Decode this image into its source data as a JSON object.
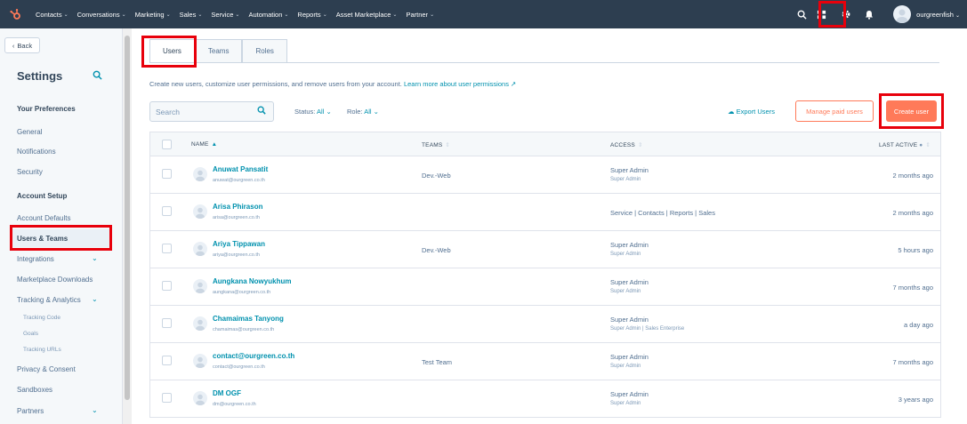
{
  "nav": {
    "items": [
      {
        "label": "Contacts"
      },
      {
        "label": "Conversations"
      },
      {
        "label": "Marketing"
      },
      {
        "label": "Sales"
      },
      {
        "label": "Service"
      },
      {
        "label": "Automation"
      },
      {
        "label": "Reports"
      },
      {
        "label": "Asset Marketplace"
      },
      {
        "label": "Partner"
      }
    ],
    "account_name": "ourgreenfish",
    "chevron": "⌄"
  },
  "sidebar": {
    "back_label": "Back",
    "title": "Settings",
    "items": [
      {
        "label": "Your Preferences"
      },
      {
        "label": "General"
      },
      {
        "label": "Notifications"
      },
      {
        "label": "Security"
      },
      {
        "label": "Account Setup"
      },
      {
        "label": "Account Defaults"
      },
      {
        "label": "Users & Teams"
      },
      {
        "label": "Integrations"
      },
      {
        "label": "Marketplace Downloads"
      },
      {
        "label": "Tracking & Analytics"
      },
      {
        "label": "Tracking Code"
      },
      {
        "label": "Goals"
      },
      {
        "label": "Tracking URLs"
      },
      {
        "label": "Privacy & Consent"
      },
      {
        "label": "Sandboxes"
      },
      {
        "label": "Partners"
      }
    ]
  },
  "tabs": [
    {
      "label": "Users"
    },
    {
      "label": "Teams"
    },
    {
      "label": "Roles"
    }
  ],
  "intro": {
    "text": "Create new users, customize user permissions, and remove users from your account.",
    "link": "Learn more about user permissions"
  },
  "toolbar": {
    "search_placeholder": "Search",
    "status_label": "Status:",
    "status_value": "All",
    "role_label": "Role:",
    "role_value": "All",
    "export_label": "Export Users",
    "manage_label": "Manage paid users",
    "create_label": "Create user"
  },
  "table": {
    "headers": {
      "name": "NAME",
      "teams": "TEAMS",
      "access": "ACCESS",
      "last_active": "LAST ACTIVE"
    },
    "rows": [
      {
        "name": "Anuwat Pansatit",
        "email": "anuwat@ourgreen.co.th",
        "team": "Dev.-Web",
        "access": "Super Admin",
        "access_sub": "Super Admin",
        "last": "2 months ago"
      },
      {
        "name": "Arisa Phirason",
        "email": "arisa@ourgreen.co.th",
        "team": "",
        "access": "Service | Contacts | Reports | Sales",
        "access_sub": "",
        "last": "2 months ago"
      },
      {
        "name": "Ariya Tippawan",
        "email": "ariya@ourgreen.co.th",
        "team": "Dev.-Web",
        "access": "Super Admin",
        "access_sub": "Super Admin",
        "last": "5 hours ago"
      },
      {
        "name": "Aungkana Nowyukhum",
        "email": "aungkana@ourgreen.co.th",
        "team": "",
        "access": "Super Admin",
        "access_sub": "Super Admin",
        "last": "7 months ago"
      },
      {
        "name": "Chamaimas Tanyong",
        "email": "chamaimas@ourgreen.co.th",
        "team": "",
        "access": "Super Admin",
        "access_sub": "Super Admin | Sales Enterprise",
        "last": "a day ago"
      },
      {
        "name": "contact@ourgreen.co.th",
        "email": "contact@ourgreen.co.th",
        "team": "Test Team",
        "access": "Super Admin",
        "access_sub": "Super Admin",
        "last": "7 months ago"
      },
      {
        "name": "DM OGF",
        "email": "dm@ourgreen.co.th",
        "team": "",
        "access": "Super Admin",
        "access_sub": "Super Admin",
        "last": "3 years ago"
      }
    ]
  },
  "colors": {
    "nav_bg": "#2d3e50",
    "accent": "#ff7a59",
    "link": "#0091ae",
    "highlight": "#e8000b"
  }
}
